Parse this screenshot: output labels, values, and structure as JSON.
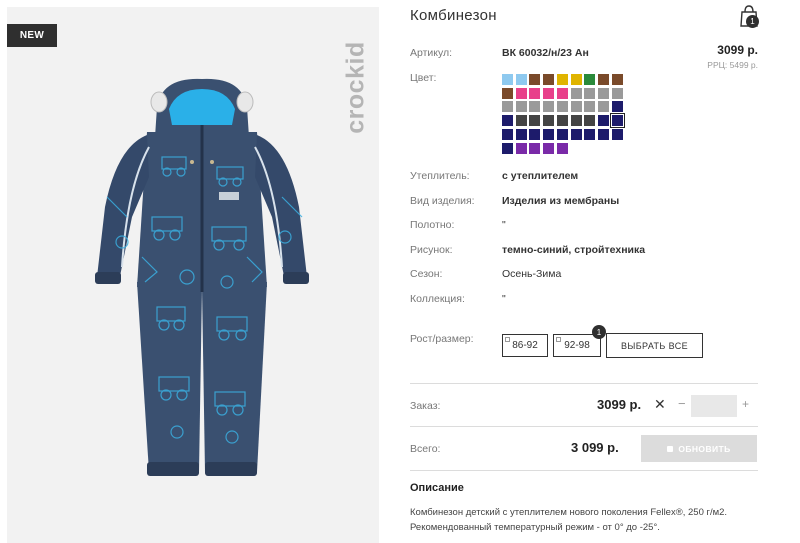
{
  "image_panel": {
    "badge": "NEW",
    "brand": "crockid"
  },
  "product": {
    "title": "Комбинезон",
    "cart_count": "1",
    "article_label": "Артикул:",
    "article_value": "ВК 60032/н/23 Ан",
    "price": "3099 р.",
    "rrp": "РРЦ: 5499 р.",
    "color_label": "Цвет:",
    "swatches": [
      [
        "#8ec9ef",
        "#8ec9ef",
        "#7a4a2a",
        "#7a4a2a",
        "#e0b400",
        "#e0b400",
        "#2a8a3a",
        "#7a4a2a",
        "#7a4a2a"
      ],
      [
        "#7a4a2a",
        "#e8408a",
        "#e8408a",
        "#e8408a",
        "#e8408a",
        "#9a9a9a",
        "#9a9a9a",
        "#9a9a9a",
        "#9a9a9a"
      ],
      [
        "#9a9a9a",
        "#9a9a9a",
        "#9a9a9a",
        "#9a9a9a",
        "#9a9a9a",
        "#9a9a9a",
        "#9a9a9a",
        "#9a9a9a",
        "#1d1b6b"
      ],
      [
        "#1d1b6b",
        "#444444",
        "#444444",
        "#444444",
        "#444444",
        "#444444",
        "#444444",
        "#1d1b6b",
        "#1d1b6b"
      ],
      [
        "#1d1b6b",
        "#1d1b6b",
        "#1d1b6b",
        "#1d1b6b",
        "#1d1b6b",
        "#1d1b6b",
        "#1d1b6b",
        "#1d1b6b",
        "#1d1b6b"
      ],
      [
        "#1d1b6b",
        "#7a2aa8",
        "#7a2aa8",
        "#7a2aa8",
        "#7a2aa8"
      ]
    ],
    "attributes": [
      {
        "label": "Утеплитель:",
        "value": "с утеплителем",
        "bold": true
      },
      {
        "label": "Вид изделия:",
        "value": "Изделия из мембраны",
        "bold": true
      },
      {
        "label": "Полотно:",
        "value": "\"",
        "bold": false
      },
      {
        "label": "Рисунок:",
        "value": "темно-синий, стройтехника",
        "bold": true
      },
      {
        "label": "Сезон:",
        "value": "Осень-Зима",
        "bold": false
      },
      {
        "label": "Коллекция:",
        "value": "\"",
        "bold": false
      }
    ],
    "size_label": "Рост/размер:",
    "sizes": [
      "86-92",
      "92-98"
    ],
    "size_count": "1",
    "select_all": "ВЫБРАТЬ ВСЕ",
    "order_label": "Заказ:",
    "order_price": "3099 р.",
    "order_x": "✕",
    "order_minus": "−",
    "order_plus": "+",
    "qty_value": "",
    "total_label": "Всего:",
    "total_price": "3 099 р.",
    "update_label": "ОБНОВИТЬ",
    "description_title": "Описание",
    "description_text": "Комбинезон детский с утеплителем нового поколения Fellex®, 250 г/м2. Рекомендованный температурный режим - от 0° до -25°."
  },
  "colors": {
    "badge_bg": "#2f2f2f",
    "garment": "#3a5070",
    "garment_pattern": "#3aaee0",
    "hood_lining": "#2ab0e8",
    "button_disabled": "#dcdcdc"
  }
}
